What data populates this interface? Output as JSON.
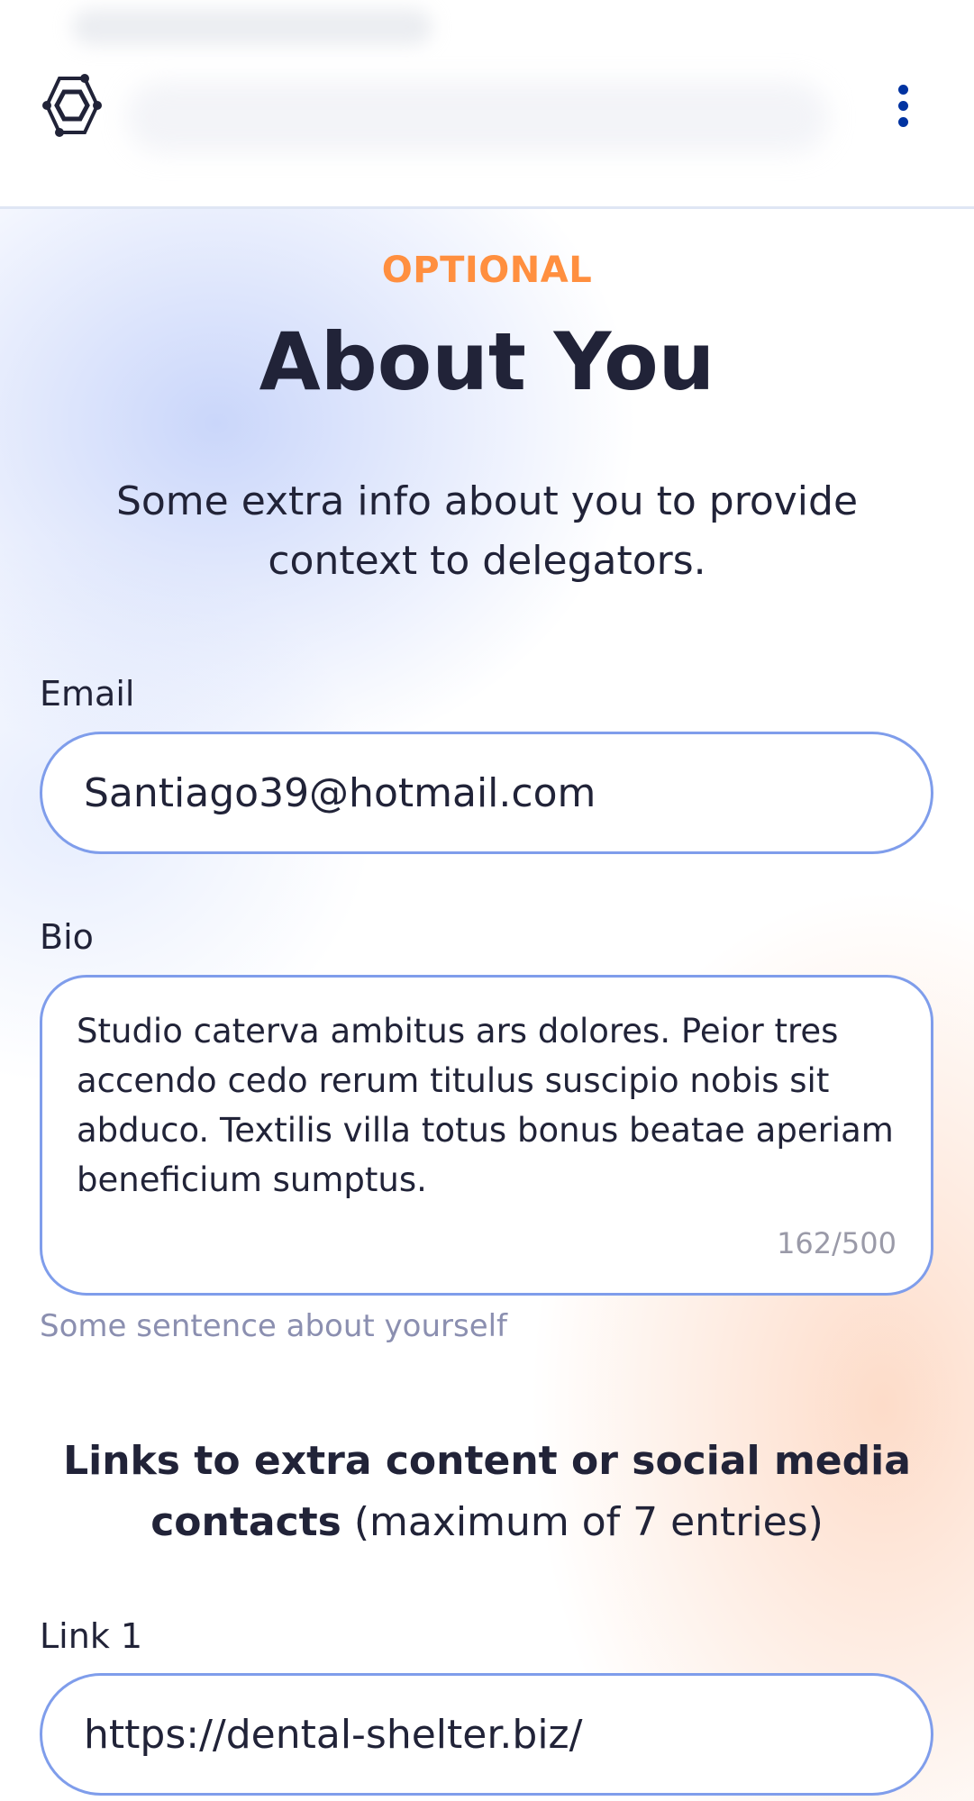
{
  "header": {
    "logo_icon": "hexagon-logo-icon",
    "menu_icon": "kebab-menu-icon",
    "accent_color": "#0033a1"
  },
  "intro": {
    "eyebrow": "OPTIONAL",
    "eyebrow_color": "#ff8f3f",
    "title": "About You",
    "subtitle": "Some extra info about you to provide context to delegators."
  },
  "form": {
    "email": {
      "label": "Email",
      "value": "Santiago39@hotmail.com"
    },
    "bio": {
      "label": "Bio",
      "value": "Studio caterva ambitus ars dolores. Peior tres accendo cedo rerum titulus suscipio nobis sit abduco. Textilis villa totus bonus beatae aperiam beneficium sumptus.",
      "counter": "162/500",
      "helper": "Some sentence about yourself"
    },
    "links_section": {
      "heading_bold": "Links to extra content or social media contacts",
      "heading_normal": " (maximum of 7 entries)"
    },
    "link_1": {
      "label": "Link 1",
      "value": "https://dental-shelter.biz/"
    }
  },
  "colors": {
    "input_border": "#7f9deb",
    "text": "#212338",
    "helper": "#8b8fb0"
  }
}
